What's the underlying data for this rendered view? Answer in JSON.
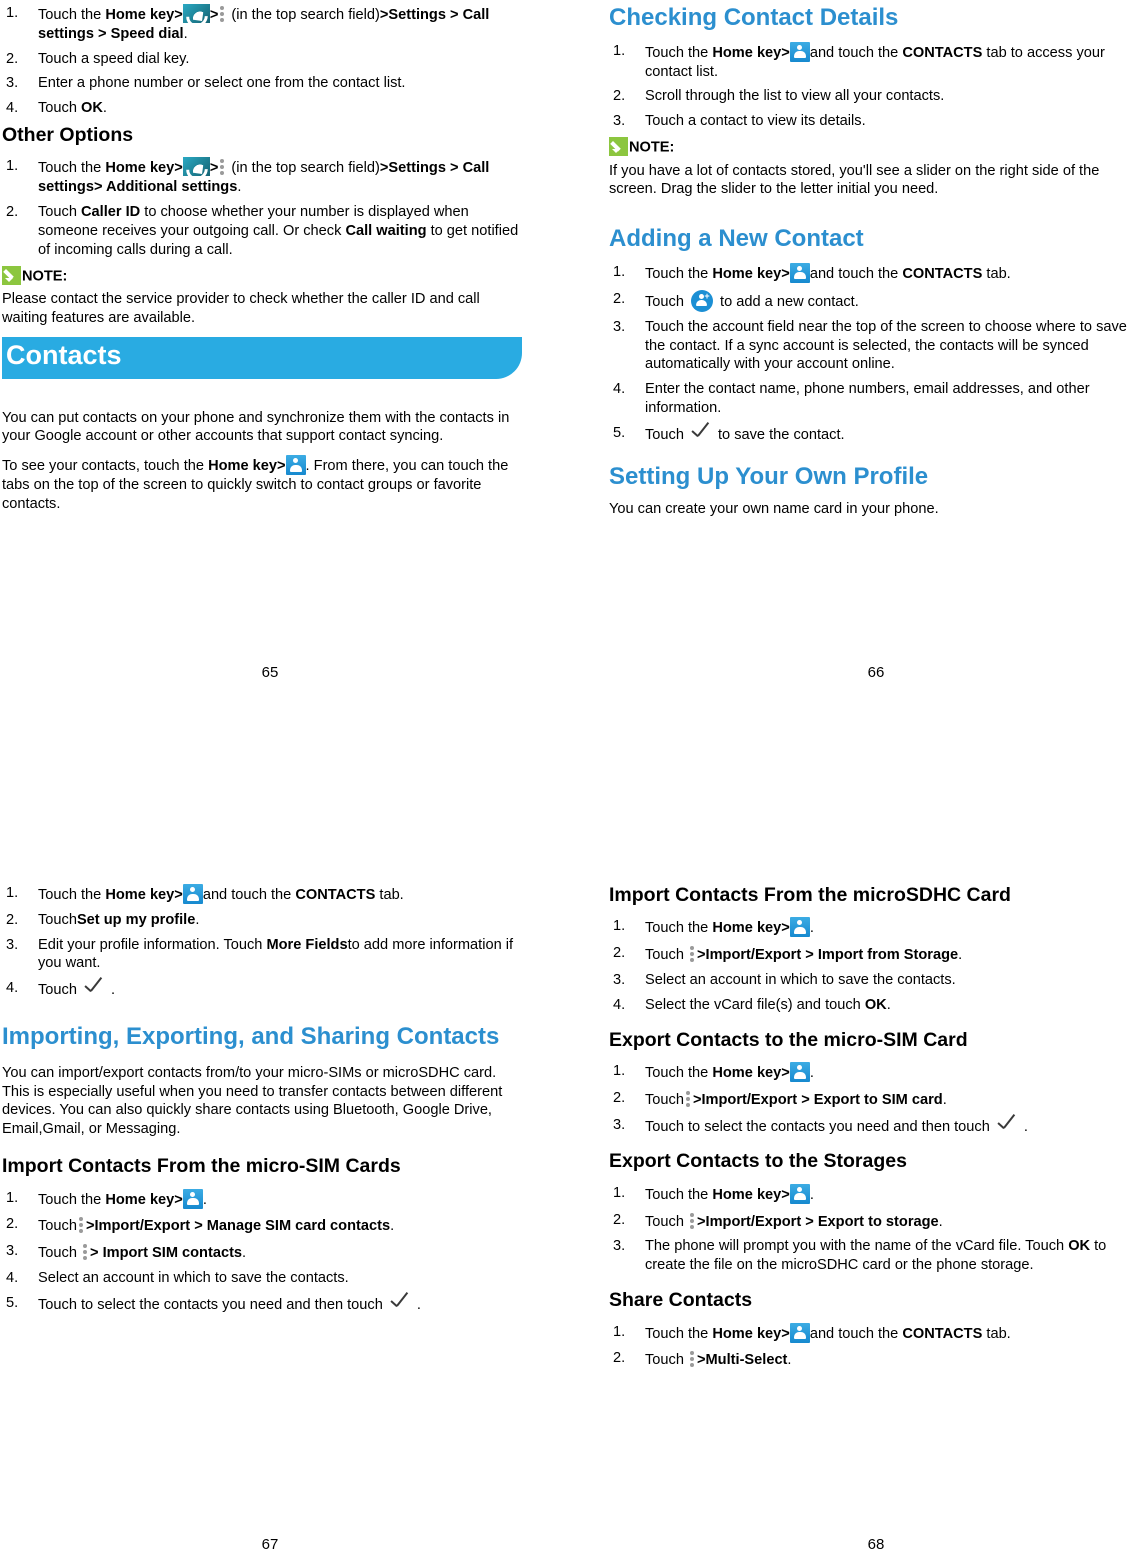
{
  "icons": {
    "phone_app": "phone-app-icon",
    "overflow_menu": "three-dot-menu-icon",
    "contacts_app": "contacts-app-icon",
    "add_contact": "add-contact-icon",
    "note_pencil": "pencil-icon",
    "checkmark": "checkmark-icon"
  },
  "colors": {
    "heading_blue": "#2C8FCF",
    "banner_blue": "#29ABE2",
    "note_green": "#8CC63F",
    "contacts_icon_blue": "#1689CF"
  },
  "pages": {
    "p65": {
      "number": "65",
      "speed_dial_steps": {
        "s1a": "Touch the ",
        "s1_home": "Home",
        "s1b": " key>",
        "s1c": ">",
        "s1d": " (in the top search field)",
        "s1_bold": ">Settings > Call settings > Speed dial",
        "s1_end": ".",
        "s2": "Touch a speed dial key.",
        "s3": "Enter a phone number or select one from the contact list.",
        "s4a": "Touch ",
        "s4_bold": "OK",
        "s4b": "."
      },
      "other_options_heading": "Other Options",
      "other_options_steps": {
        "s1a": "Touch the ",
        "s1_home": "Home",
        "s1b": " key>",
        "s1c": ">",
        "s1d": " (in the top search field)",
        "s1_bold": ">Settings > Call settings> Additional settings",
        "s1_end": ".",
        "s2a": "Touch ",
        "s2_b1": "Caller ID",
        "s2b": " to choose whether your number is displayed when someone receives your outgoing call. Or check ",
        "s2_b2": "Call waiting",
        "s2c": " to get notified of incoming calls during a call."
      },
      "note_label": "NOTE:",
      "note_text": "Please contact the service provider to check whether the caller ID and call waiting features are available.",
      "chapter_banner": "Contacts",
      "intro_p1": "You can put contacts on your phone and synchronize them with the contacts in your Google account or other accounts that support contact syncing.",
      "intro_p2a": "To see your contacts, touch the ",
      "intro_p2_home": "Home",
      "intro_p2b": " key>",
      "intro_p2c": ". From there, you can touch the tabs on the top of the screen to quickly switch to contact groups or favorite contacts."
    },
    "p66": {
      "number": "66",
      "h_checking": "Checking Contact Details",
      "checking_steps": {
        "s1a": "Touch the ",
        "s1_home": "Home",
        "s1b": " key>",
        "s1c": "and touch the ",
        "s1_bold": "CONTACTS",
        "s1d": " tab to access your contact list.",
        "s2": "Scroll through the list to view all your contacts.",
        "s3": "Touch a contact to view its details."
      },
      "note_label": "NOTE:",
      "note_text": "If you have a lot of contacts stored, you'll see a slider on the right side of the screen. Drag the slider to the letter initial you need.",
      "h_adding": "Adding a New Contact",
      "adding_steps": {
        "s1a": "Touch the ",
        "s1_home": "Home",
        "s1b": " key>",
        "s1c": "and touch the ",
        "s1_bold": "CONTACTS",
        "s1d": " tab.",
        "s2a": "Touch ",
        "s2b": " to add a new contact.",
        "s3": "Touch the account field near the top of the screen to choose where to save the contact. If a sync account is selected, the contacts will be synced automatically with your account online.",
        "s4": "Enter the contact name, phone numbers, email addresses, and other information.",
        "s5a": "Touch ",
        "s5b": "to save the contact."
      },
      "h_profile": "Setting Up Your Own Profile",
      "profile_text": "You can create your own name card in your phone."
    },
    "p67": {
      "number": "67",
      "profile_steps": {
        "s1a": "Touch the ",
        "s1_home": "Home",
        "s1b": " key>",
        "s1c": "and touch the ",
        "s1_bold": "CONTACTS",
        "s1d": " tab.",
        "s2a": "Touch",
        "s2_bold": "Set up my profile",
        "s2b": ".",
        "s3a": "Edit your profile information. Touch ",
        "s3_bold": "More Fields",
        "s3b": "to add more information if you want.",
        "s4a": "Touch ",
        "s4b": "."
      },
      "h_importing": "Importing, Exporting, and Sharing Contacts",
      "importing_text": "You can import/export contacts from/to your micro-SIMs or microSDHC card. This is especially useful when you need to transfer contacts between different devices. You can also quickly share contacts using Bluetooth, Google Drive, Email,Gmail, or Messaging.",
      "h_import_sim": "Import Contacts From the micro-SIM Cards",
      "import_sim_steps": {
        "s1a": "Touch the ",
        "s1_home": "Home",
        "s1b": " key>",
        "s1c": ".",
        "s2a": "Touch",
        "s2_bold": ">Import/Export > Manage SIM card contacts",
        "s2b": ".",
        "s3a": "Touch ",
        "s3_bold": "> Import SIM contacts",
        "s3b": ".",
        "s4": "Select an account in which to save the contacts.",
        "s5a": "Touch to select the contacts you need and then touch ",
        "s5b": "."
      }
    },
    "p68": {
      "number": "68",
      "h_import_sd": "Import Contacts From the microSDHC Card",
      "import_sd_steps": {
        "s1a": "Touch the ",
        "s1_home": "Home",
        "s1b": " key>",
        "s1c": ".",
        "s2a": "Touch ",
        "s2_bold": ">Import/Export > Import from Storage",
        "s2b": ".",
        "s3": "Select an account in which to save the contacts.",
        "s4a": "Select the vCard file(s) and touch ",
        "s4_bold": "OK",
        "s4b": "."
      },
      "h_export_sim": "Export Contacts to the micro-SIM Card",
      "export_sim_steps": {
        "s1a": "Touch the ",
        "s1_home": "Home",
        "s1b": " key>",
        "s1c": ".",
        "s2a": "Touch",
        "s2_bold": ">Import/Export > Export to SIM card",
        "s2b": ".",
        "s3a": "Touch to select the contacts you need and then touch ",
        "s3b": "."
      },
      "h_export_storage": "Export Contacts to the Storages",
      "export_storage_steps": {
        "s1a": "Touch the ",
        "s1_home": "Home",
        "s1b": " key>",
        "s1c": ".",
        "s2a": "Touch ",
        "s2_bold": ">Import/Export > Export to storage",
        "s2b": ".",
        "s3a": "The phone will prompt you with the name of the vCard file. Touch ",
        "s3_bold": "OK",
        "s3b": " to create the file on the microSDHC card or the phone storage."
      },
      "h_share": "Share Contacts",
      "share_steps": {
        "s1a": "Touch the ",
        "s1_home": "Home",
        "s1b": " key>",
        "s1c": "and touch the ",
        "s1_bold": "CONTACTS",
        "s1d": " tab.",
        "s2a": "Touch ",
        "s2_bold": ">Multi-Select",
        "s2b": "."
      }
    }
  },
  "list_numbers": {
    "n1": "1.",
    "n2": "2.",
    "n3": "3.",
    "n4": "4.",
    "n5": "5."
  }
}
